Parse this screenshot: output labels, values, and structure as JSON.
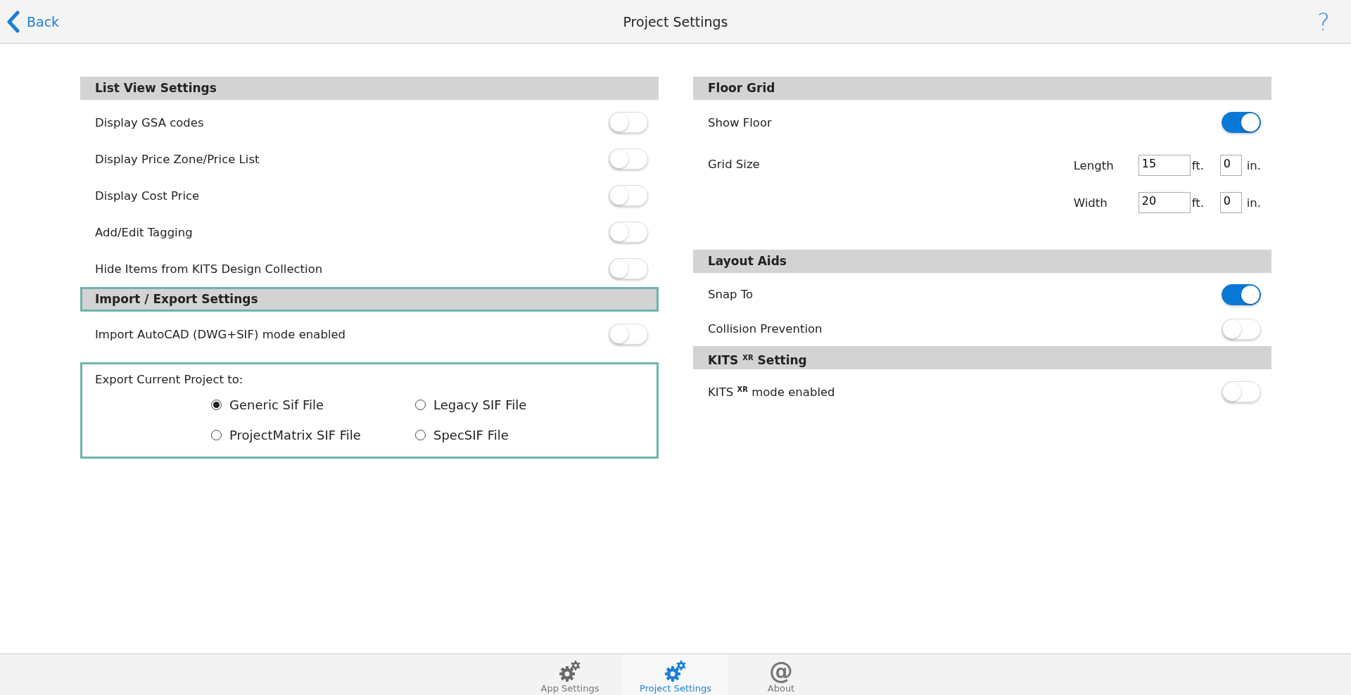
{
  "header": {
    "back": "Back",
    "title": "Project Settings",
    "help": "?"
  },
  "left_sections": [
    {
      "title": "List View Settings",
      "highlighted": false,
      "rows": [
        {
          "kind": "toggle",
          "label": "Display GSA codes",
          "on": false
        },
        {
          "kind": "toggle",
          "label": "Display Price Zone/Price List",
          "on": false
        },
        {
          "kind": "toggle",
          "label": "Display Cost Price",
          "on": false
        },
        {
          "kind": "toggle",
          "label": "Add/Edit Tagging",
          "on": false
        },
        {
          "kind": "toggle",
          "label": "Hide Items from KITS Design Collection",
          "on": false
        }
      ]
    },
    {
      "title": "Import / Export Settings",
      "highlighted": true,
      "rows": [
        {
          "kind": "toggle",
          "label": "Import AutoCAD (DWG+SIF) mode enabled",
          "on": false
        },
        {
          "kind": "radio_group",
          "label": "Export Current Project to:",
          "highlighted": true,
          "options": [
            {
              "label": "Generic Sif File",
              "selected": true
            },
            {
              "label": "Legacy SIF File",
              "selected": false
            },
            {
              "label": "ProjectMatrix SIF File",
              "selected": false
            },
            {
              "label": "SpecSIF File",
              "selected": false
            }
          ]
        }
      ]
    }
  ],
  "right_sections": [
    {
      "title": "Floor Grid",
      "highlighted": false,
      "rows": [
        {
          "kind": "toggle",
          "label": "Show Floor",
          "on": true
        },
        {
          "kind": "dimensions",
          "label": "Grid Size",
          "fields": [
            {
              "label": "Length",
              "feet": "15",
              "feet_unit": "ft.",
              "inches": "0",
              "inch_unit": "in."
            },
            {
              "label": "Width",
              "feet": "20",
              "feet_unit": "ft.",
              "inches": "0",
              "inch_unit": "in."
            }
          ]
        }
      ]
    },
    {
      "title": "Layout Aids",
      "highlighted": false,
      "rows": [
        {
          "kind": "toggle",
          "label": "Snap To",
          "on": true
        },
        {
          "kind": "toggle",
          "label": "Collision Prevention",
          "on": false
        }
      ]
    },
    {
      "title": "KITS $^{XR}$ Setting",
      "highlighted": false,
      "rows": [
        {
          "kind": "toggle",
          "label": "KITS $^{XR}$ mode enabled",
          "on": false
        }
      ]
    }
  ],
  "tab_bar": [
    {
      "kind": "gears",
      "label": "App Settings",
      "selected": false
    },
    {
      "kind": "gears",
      "label": "Project Settings",
      "selected": true
    },
    {
      "kind": "at",
      "glyph": "@",
      "label": "About",
      "selected": false
    }
  ]
}
